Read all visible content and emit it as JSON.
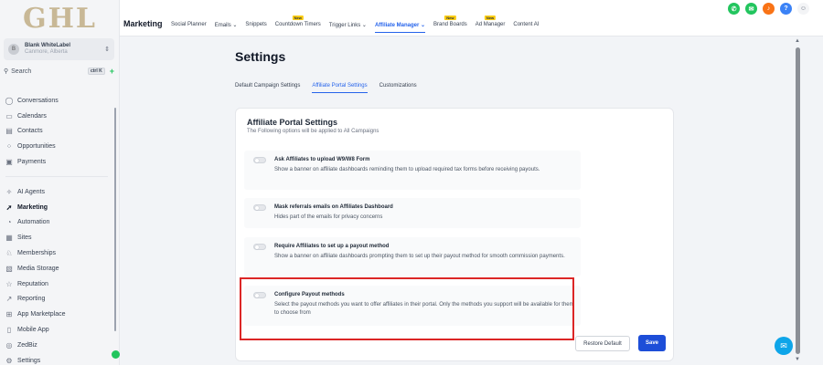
{
  "logo": "GHL",
  "account": {
    "avatar": "B",
    "name": "Blank WhiteLabel",
    "location": "Canmore, Alberta"
  },
  "search": {
    "label": "Search",
    "shortcut": "ctrl K"
  },
  "sidebar": {
    "nav_top": [
      {
        "label": "Conversations",
        "icon": "chat-bubble-icon",
        "glyph": "◯"
      },
      {
        "label": "Calendars",
        "icon": "calendar-icon",
        "glyph": "▭"
      },
      {
        "label": "Contacts",
        "icon": "contacts-icon",
        "glyph": "▤"
      },
      {
        "label": "Opportunities",
        "icon": "opportunities-icon",
        "glyph": "⁘"
      },
      {
        "label": "Payments",
        "icon": "payments-icon",
        "glyph": "▣"
      }
    ],
    "nav_bottom": [
      {
        "label": "AI Agents",
        "icon": "ai-sparkle-icon",
        "glyph": "✧"
      },
      {
        "label": "Marketing",
        "icon": "send-icon",
        "glyph": "➚",
        "active": true
      },
      {
        "label": "Automation",
        "icon": "automation-icon",
        "glyph": "◔"
      },
      {
        "label": "Sites",
        "icon": "sites-icon",
        "glyph": "▦"
      },
      {
        "label": "Memberships",
        "icon": "memberships-icon",
        "glyph": "♘"
      },
      {
        "label": "Media Storage",
        "icon": "media-storage-icon",
        "glyph": "▧"
      },
      {
        "label": "Reputation",
        "icon": "star-icon",
        "glyph": "☆"
      },
      {
        "label": "Reporting",
        "icon": "reporting-icon",
        "glyph": "↗"
      },
      {
        "label": "App Marketplace",
        "icon": "app-grid-icon",
        "glyph": "⊞"
      },
      {
        "label": "Mobile App",
        "icon": "mobile-icon",
        "glyph": "▯"
      },
      {
        "label": "ZedBiz",
        "icon": "zedbiz-icon",
        "glyph": "◎"
      },
      {
        "label": "Settings",
        "icon": "settings-icon",
        "glyph": "⚙"
      }
    ]
  },
  "topbar": {
    "section": "Marketing",
    "nav": [
      {
        "label": "Social Planner"
      },
      {
        "label": "Emails ⌄"
      },
      {
        "label": "Snippets"
      },
      {
        "label": "Countdown Timers",
        "badge": "New"
      },
      {
        "label": "Trigger Links ⌄"
      },
      {
        "label": "Affiliate Manager ⌄",
        "active": true
      },
      {
        "label": "Brand Boards",
        "badge": "New"
      },
      {
        "label": "Ad Manager",
        "badge": "New"
      },
      {
        "label": "Content AI"
      }
    ],
    "icons": [
      {
        "name": "phone-icon",
        "cls": "phone",
        "glyph": "✆"
      },
      {
        "name": "megaphone-icon",
        "cls": "mega",
        "glyph": "✉"
      },
      {
        "name": "notification-bell-icon",
        "cls": "bell",
        "glyph": "♪"
      },
      {
        "name": "help-icon",
        "cls": "help",
        "glyph": "?"
      },
      {
        "name": "user-avatar-icon",
        "cls": "user",
        "glyph": "☺"
      }
    ]
  },
  "page": {
    "title": "Settings",
    "tabs": [
      {
        "label": "Default Campaign Settings"
      },
      {
        "label": "Affiliate Portal Settings",
        "active": true
      },
      {
        "label": "Customizations"
      }
    ]
  },
  "card": {
    "title": "Affiliate Portal Settings",
    "subtitle": "The Following options will be applied to All Campaigns",
    "settings": [
      {
        "title": "Ask Affiliates to upload W9/W8 Form",
        "description": "Show a banner on affiliate dashboards reminding them to upload required tax forms before receiving payouts.",
        "enabled": false
      },
      {
        "title": "Mask referrals emails on Affiliates Dashboard",
        "description": "Hides part of the emails for privacy concerns",
        "enabled": false
      },
      {
        "title": "Require Affiliates to set up a payout method",
        "description": "Show a banner on affiliate dashboards prompting them to set up their payout method for smooth commission payments.",
        "enabled": false
      },
      {
        "title": "Configure Payout methods",
        "description": "Select the payout methods you want to offer affiliates in their portal. Only the methods you support will be available for them to choose from",
        "enabled": false
      }
    ],
    "restore_label": "Restore Default",
    "save_label": "Save"
  }
}
